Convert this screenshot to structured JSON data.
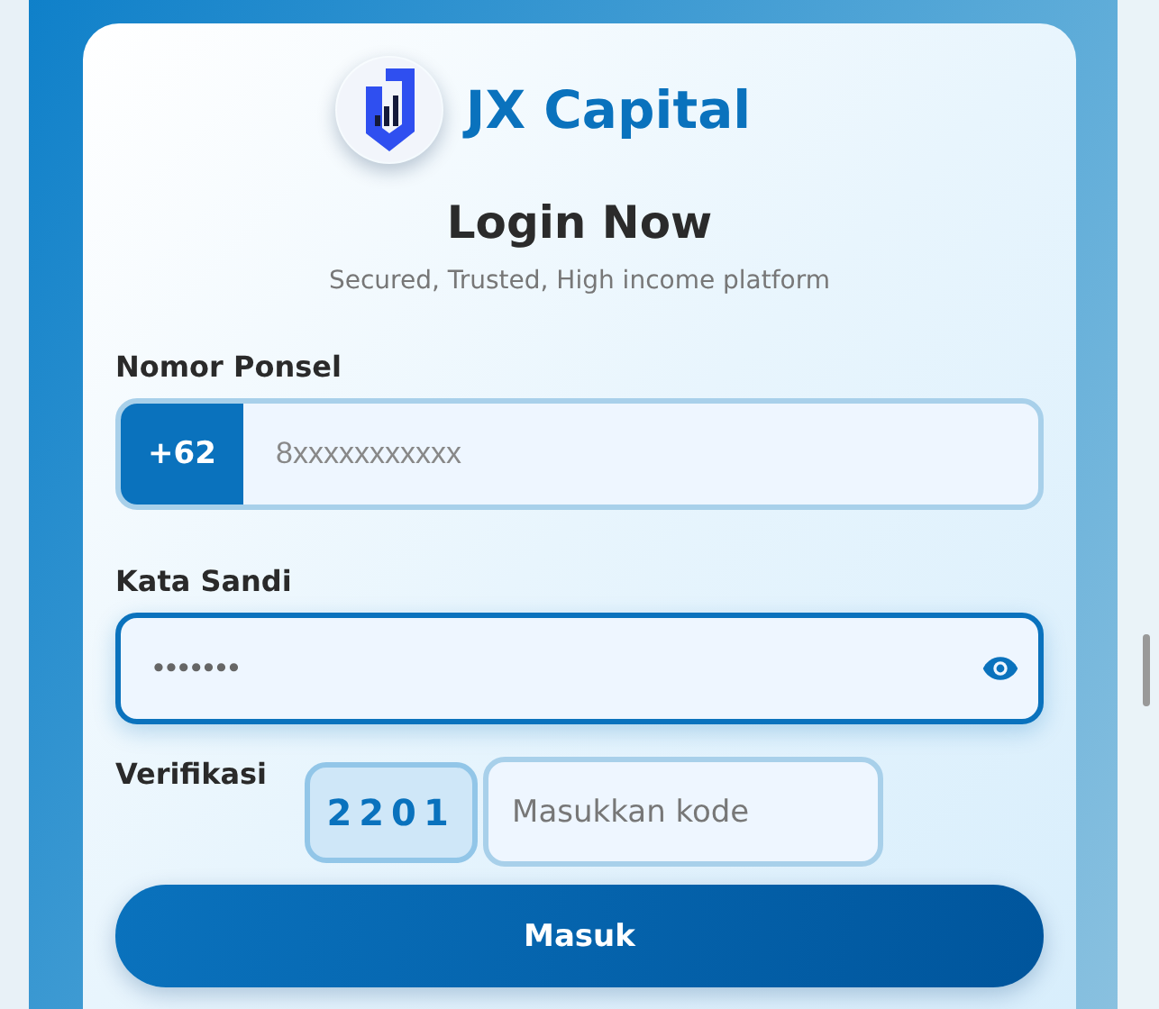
{
  "brand": {
    "name": "JX Capital"
  },
  "heading": "Login Now",
  "subtitle": "Secured, Trusted, High income platform",
  "phone": {
    "label": "Nomor Ponsel",
    "prefix": "+62",
    "placeholder": "8xxxxxxxxxxx",
    "focused": false
  },
  "password": {
    "label": "Kata Sandi",
    "value": "•••••••",
    "focused": true
  },
  "verification": {
    "label": "Verifikasi",
    "code": "2201",
    "placeholder": "Masukkan kode"
  },
  "submit": "Masuk"
}
